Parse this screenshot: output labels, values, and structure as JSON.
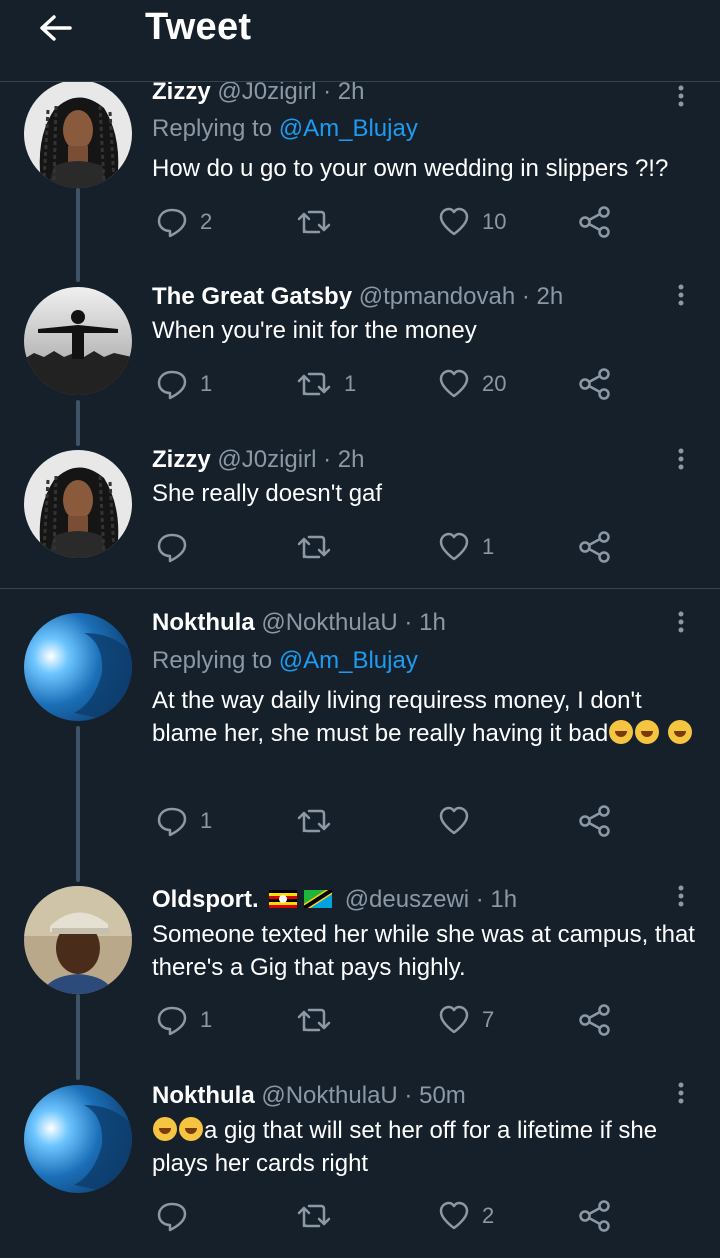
{
  "header": {
    "title": "Tweet"
  },
  "tweets": [
    {
      "name": "Zizzy",
      "meta": "@J0zigirl · 2h",
      "replying_label": "Replying to ",
      "replying_handle": "@Am_Blujay",
      "text": "How do u go to your own wedding in slippers ?!?",
      "replies": "2",
      "retweets": "",
      "likes": "10",
      "avatar": "woman-braids"
    },
    {
      "name": "The Great Gatsby",
      "meta": "@tpmandovah · 2h",
      "text": "When you're init for the money",
      "replies": "1",
      "retweets": "1",
      "likes": "20",
      "avatar": "man-city"
    },
    {
      "name": "Zizzy",
      "meta": "@J0zigirl · 2h",
      "text": "She really doesn't gaf",
      "replies": "",
      "retweets": "",
      "likes": "1",
      "avatar": "woman-braids"
    },
    {
      "name": "Nokthula",
      "meta": "@NokthulaU · 1h",
      "replying_label": "Replying to ",
      "replying_handle": "@Am_Blujay",
      "text": "At the way daily living requiress money, I don't blame her, she must be really having it bad",
      "replies": "1",
      "retweets": "",
      "likes": "",
      "avatar": "blue-light"
    },
    {
      "name": "Oldsport.",
      "meta": "@deuszewi · 1h",
      "text": "Someone texted her while she was at campus, that there's a Gig that pays highly.",
      "replies": "1",
      "retweets": "",
      "likes": "7",
      "avatar": "man-cap",
      "flags": [
        "uganda-flag",
        "tanzania-flag"
      ]
    },
    {
      "name": "Nokthula",
      "meta": "@NokthulaU · 50m",
      "text": "a gig that will set her off for a lifetime if she plays her cards right",
      "replies": "",
      "retweets": "",
      "likes": "2",
      "avatar": "blue-light"
    }
  ],
  "icons": {
    "reply": "reply-icon",
    "retweet": "retweet-icon",
    "like": "heart-icon",
    "share": "share-icon",
    "more": "more-icon",
    "emoji": "rofl-emoji"
  },
  "colors": {
    "background": "#15202b",
    "link": "#1d9bf0",
    "muted": "#8b98a5",
    "divider": "#38444d"
  }
}
